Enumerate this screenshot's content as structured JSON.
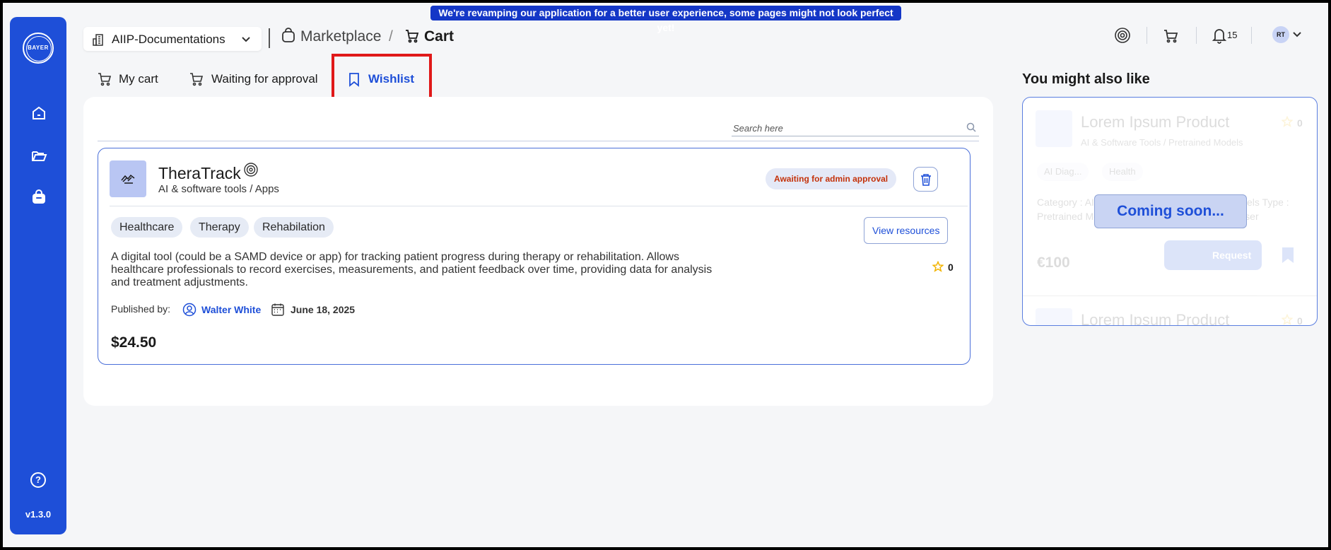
{
  "banner": {
    "text": "We're revamping our application for a better user experience, some pages might not look perfect yet!"
  },
  "sidebar": {
    "logo_text": "BAYER",
    "items": [
      {
        "name": "home",
        "icon": "home-icon"
      },
      {
        "name": "projects",
        "icon": "folder-icon"
      },
      {
        "name": "marketplace",
        "icon": "bag-icon"
      }
    ],
    "help_label": "?",
    "version": "v1.3.0"
  },
  "header": {
    "org_select": "AIIP-Documentations",
    "breadcrumb": {
      "marketplace": "Marketplace",
      "separator": "/",
      "current": "Cart"
    },
    "notifications_count": "15",
    "avatar_initials": "RT"
  },
  "tabs": [
    {
      "label": "My cart",
      "icon": "cart-icon",
      "active": false
    },
    {
      "label": "Waiting for approval",
      "icon": "cart-clock-icon",
      "active": false
    },
    {
      "label": "Wishlist",
      "icon": "bookmark-icon",
      "active": true
    }
  ],
  "search": {
    "placeholder": "Search here",
    "value": ""
  },
  "product": {
    "name": "TheraTrack",
    "category": "AI & software tools / Apps",
    "status": "Awaiting for admin approval",
    "tags": [
      "Healthcare",
      "Therapy",
      "Rehabilation"
    ],
    "view_button": "View resources",
    "description": "A digital tool (could be a SAMD device or app) for tracking patient progress during therapy or rehabilitation. Allows healthcare professionals to record exercises, measurements, and patient feedback over time, providing data for analysis and treatment adjustments.",
    "rating": "0",
    "published_label": "Published by:",
    "publisher": "Walter White",
    "date": "June 18, 2025",
    "price": "$24.50"
  },
  "recommendations": {
    "title": "You might also like",
    "item": {
      "name": "Lorem Ipsum Product",
      "category": "AI & Software Tools / Pretrained Models",
      "rating": "0",
      "tags": [
        "AI Diag...",
        "Health"
      ],
      "meta": "Category : AI & Software Tools / Pretrained Models    Type : Pretrained Model, Ready to use model for the user",
      "price": "€100",
      "request_label": "Request"
    },
    "item2_name": "Lorem Ipsum Product",
    "item2_rating": "0",
    "overlay": "Coming soon..."
  },
  "colors": {
    "primary": "#1e4fd8",
    "sidebar": "#1e4fd8",
    "status_text": "#c4320a",
    "highlight": "#e01919",
    "star": "#f2b300"
  }
}
